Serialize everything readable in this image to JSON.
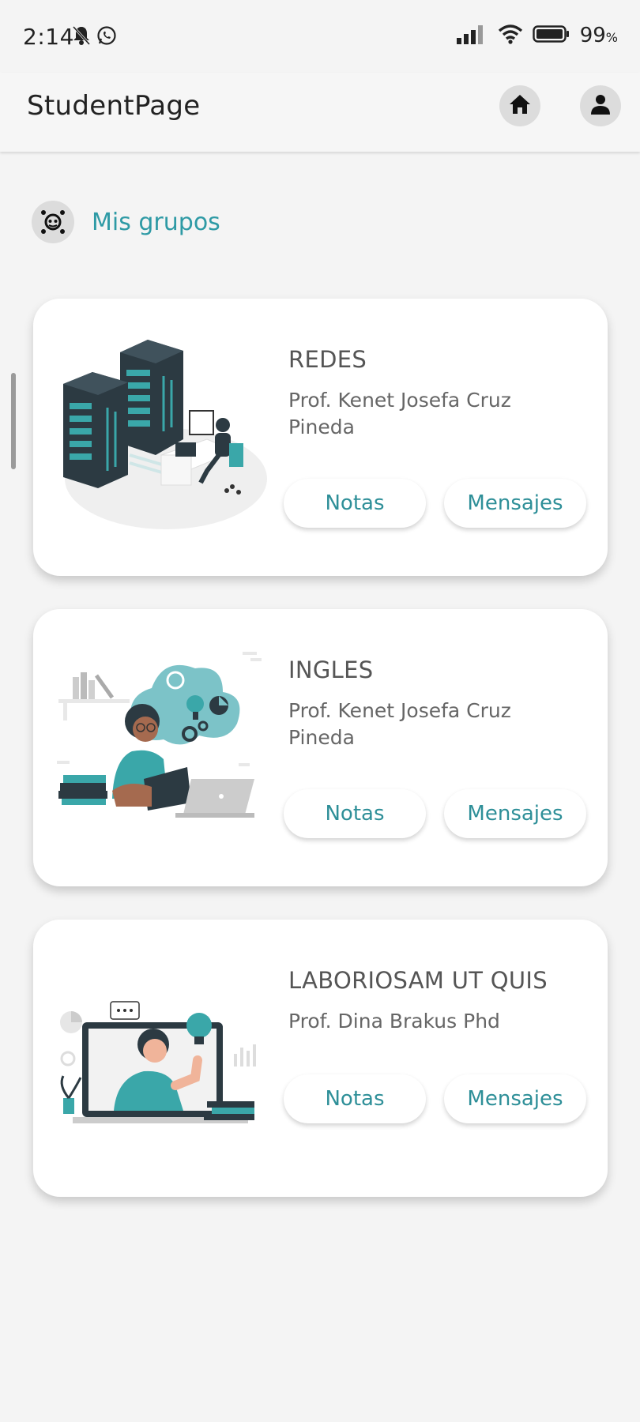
{
  "status_bar": {
    "time": "2:14",
    "battery": "99",
    "battery_unit": "%"
  },
  "app_bar": {
    "title": "StudentPage",
    "home_icon": "home-icon",
    "profile_icon": "person-icon"
  },
  "section": {
    "title": "Mis grupos",
    "icon": "groups-icon"
  },
  "colors": {
    "accent": "#2e9aa5",
    "card_bg": "#ffffff",
    "page_bg": "#f4f4f4"
  },
  "groups": [
    {
      "name": "REDES",
      "teacher": "Prof. Kenet Josefa Cruz Pineda",
      "notes_label": "Notas",
      "messages_label": "Mensajes",
      "illustration": "server-room-illustration"
    },
    {
      "name": "INGLES",
      "teacher": "Prof. Kenet Josefa Cruz Pineda",
      "notes_label": "Notas",
      "messages_label": "Mensajes",
      "illustration": "student-reading-illustration"
    },
    {
      "name": "LABORIOSAM UT QUIS",
      "teacher": "Prof. Dina Brakus Phd",
      "notes_label": "Notas",
      "messages_label": "Mensajes",
      "illustration": "online-class-illustration"
    }
  ]
}
